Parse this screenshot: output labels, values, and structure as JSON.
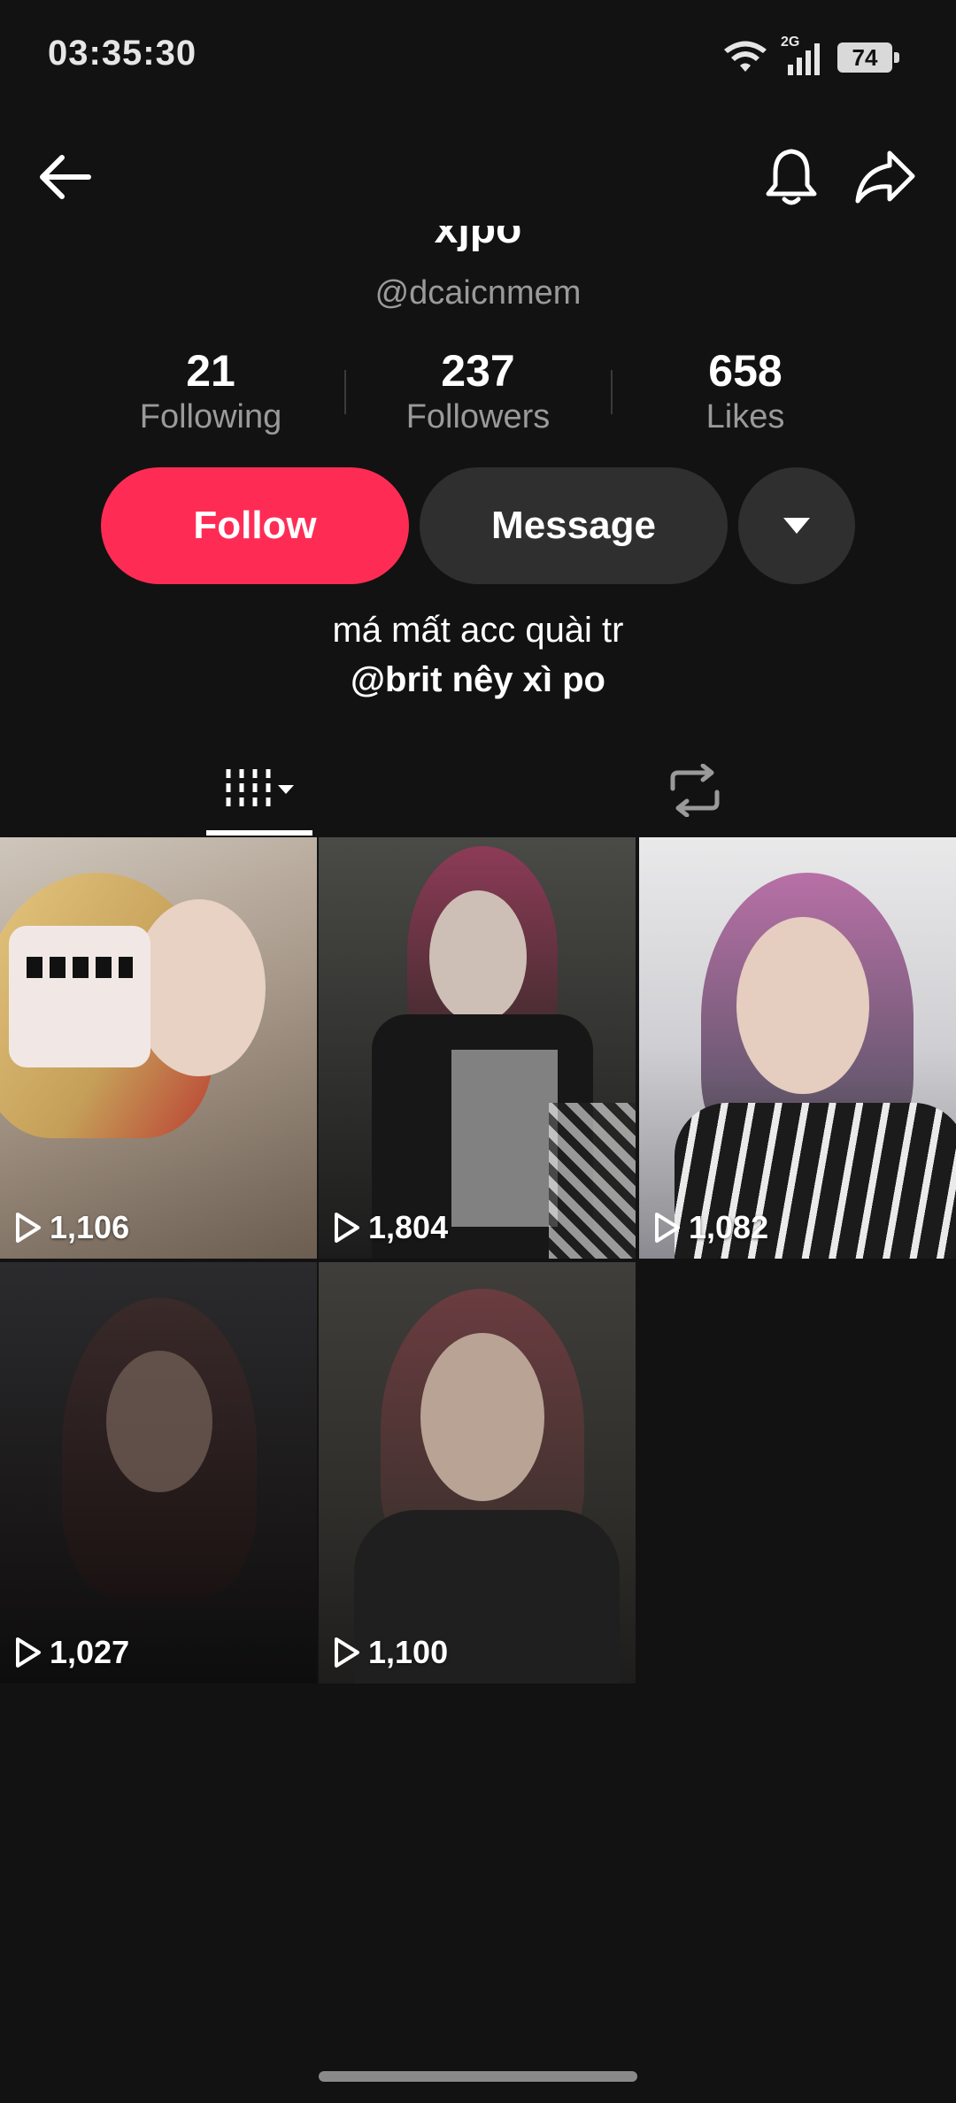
{
  "status_bar": {
    "time": "03:35:30",
    "network": "2G",
    "battery": "74"
  },
  "profile": {
    "display_name": "xjpo",
    "username": "@dcaicnmem",
    "stats": [
      {
        "value": "21",
        "label": "Following"
      },
      {
        "value": "237",
        "label": "Followers"
      },
      {
        "value": "658",
        "label": "Likes"
      }
    ],
    "buttons": {
      "follow": "Follow",
      "message": "Message"
    },
    "bio": {
      "line1": "má mất acc quài tr",
      "line2": "@brit nêy xì po"
    }
  },
  "tabs": {
    "active": "videos"
  },
  "videos": [
    {
      "views": "1,106"
    },
    {
      "views": "1,804"
    },
    {
      "views": "1,082"
    },
    {
      "views": "1,027"
    },
    {
      "views": "1,100"
    }
  ],
  "colors": {
    "background": "#121212",
    "accent": "#fe2c55",
    "secondary_button": "#2f2f2f",
    "muted_text": "#9a9a9a"
  }
}
